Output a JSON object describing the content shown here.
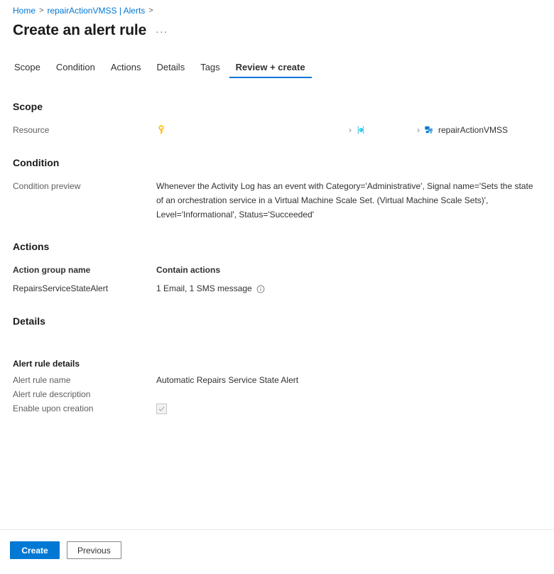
{
  "breadcrumb": {
    "items": [
      {
        "label": "Home",
        "icon": ""
      },
      {
        "label": "repairActionVMSS | Alerts",
        "icon": ""
      }
    ],
    "separator": ">"
  },
  "header": {
    "title": "Create an alert rule",
    "more_menu": "···"
  },
  "tabs": [
    {
      "label": "Scope",
      "active": false
    },
    {
      "label": "Condition",
      "active": false
    },
    {
      "label": "Actions",
      "active": false
    },
    {
      "label": "Details",
      "active": false
    },
    {
      "label": "Tags",
      "active": false
    },
    {
      "label": "Review + create",
      "active": true
    }
  ],
  "scope": {
    "heading": "Scope",
    "resource_label": "Resource",
    "path": [
      {
        "icon": "key-icon",
        "name": ""
      },
      {
        "icon": "resource-group-icon",
        "name": ""
      },
      {
        "icon": "vmss-icon",
        "name": "repairActionVMSS"
      }
    ],
    "separator": "›"
  },
  "condition": {
    "heading": "Condition",
    "preview_label": "Condition preview",
    "preview_text": "Whenever the Activity Log has an event with Category='Administrative', Signal name='Sets the state of an orchestration service in a Virtual Machine Scale Set. (Virtual Machine Scale Sets)', Level='Informational', Status='Succeeded'"
  },
  "actions": {
    "heading": "Actions",
    "columns": [
      "Action group name",
      "Contain actions"
    ],
    "rows": [
      {
        "action_group_name": "RepairsServiceStateAlert",
        "contain_actions": "1 Email, 1 SMS message"
      }
    ]
  },
  "details": {
    "heading": "Details",
    "subheading": "Alert rule details",
    "fields": [
      {
        "label": "Alert rule name",
        "value": "Automatic Repairs Service State Alert"
      },
      {
        "label": "Alert rule description",
        "value": ""
      },
      {
        "label": "Enable upon creation",
        "value": "",
        "type": "checkbox",
        "checked": true
      }
    ]
  },
  "footer": {
    "create_label": "Create",
    "previous_label": "Previous"
  },
  "colors": {
    "accent": "#0078d4",
    "link": "#0078d4",
    "text": "#323130",
    "muted": "#605e5c",
    "key_icon": "#ffb900",
    "rg_icon": "#32bedd",
    "vmss_icon": "#0078d4",
    "border": "#edebe9"
  }
}
